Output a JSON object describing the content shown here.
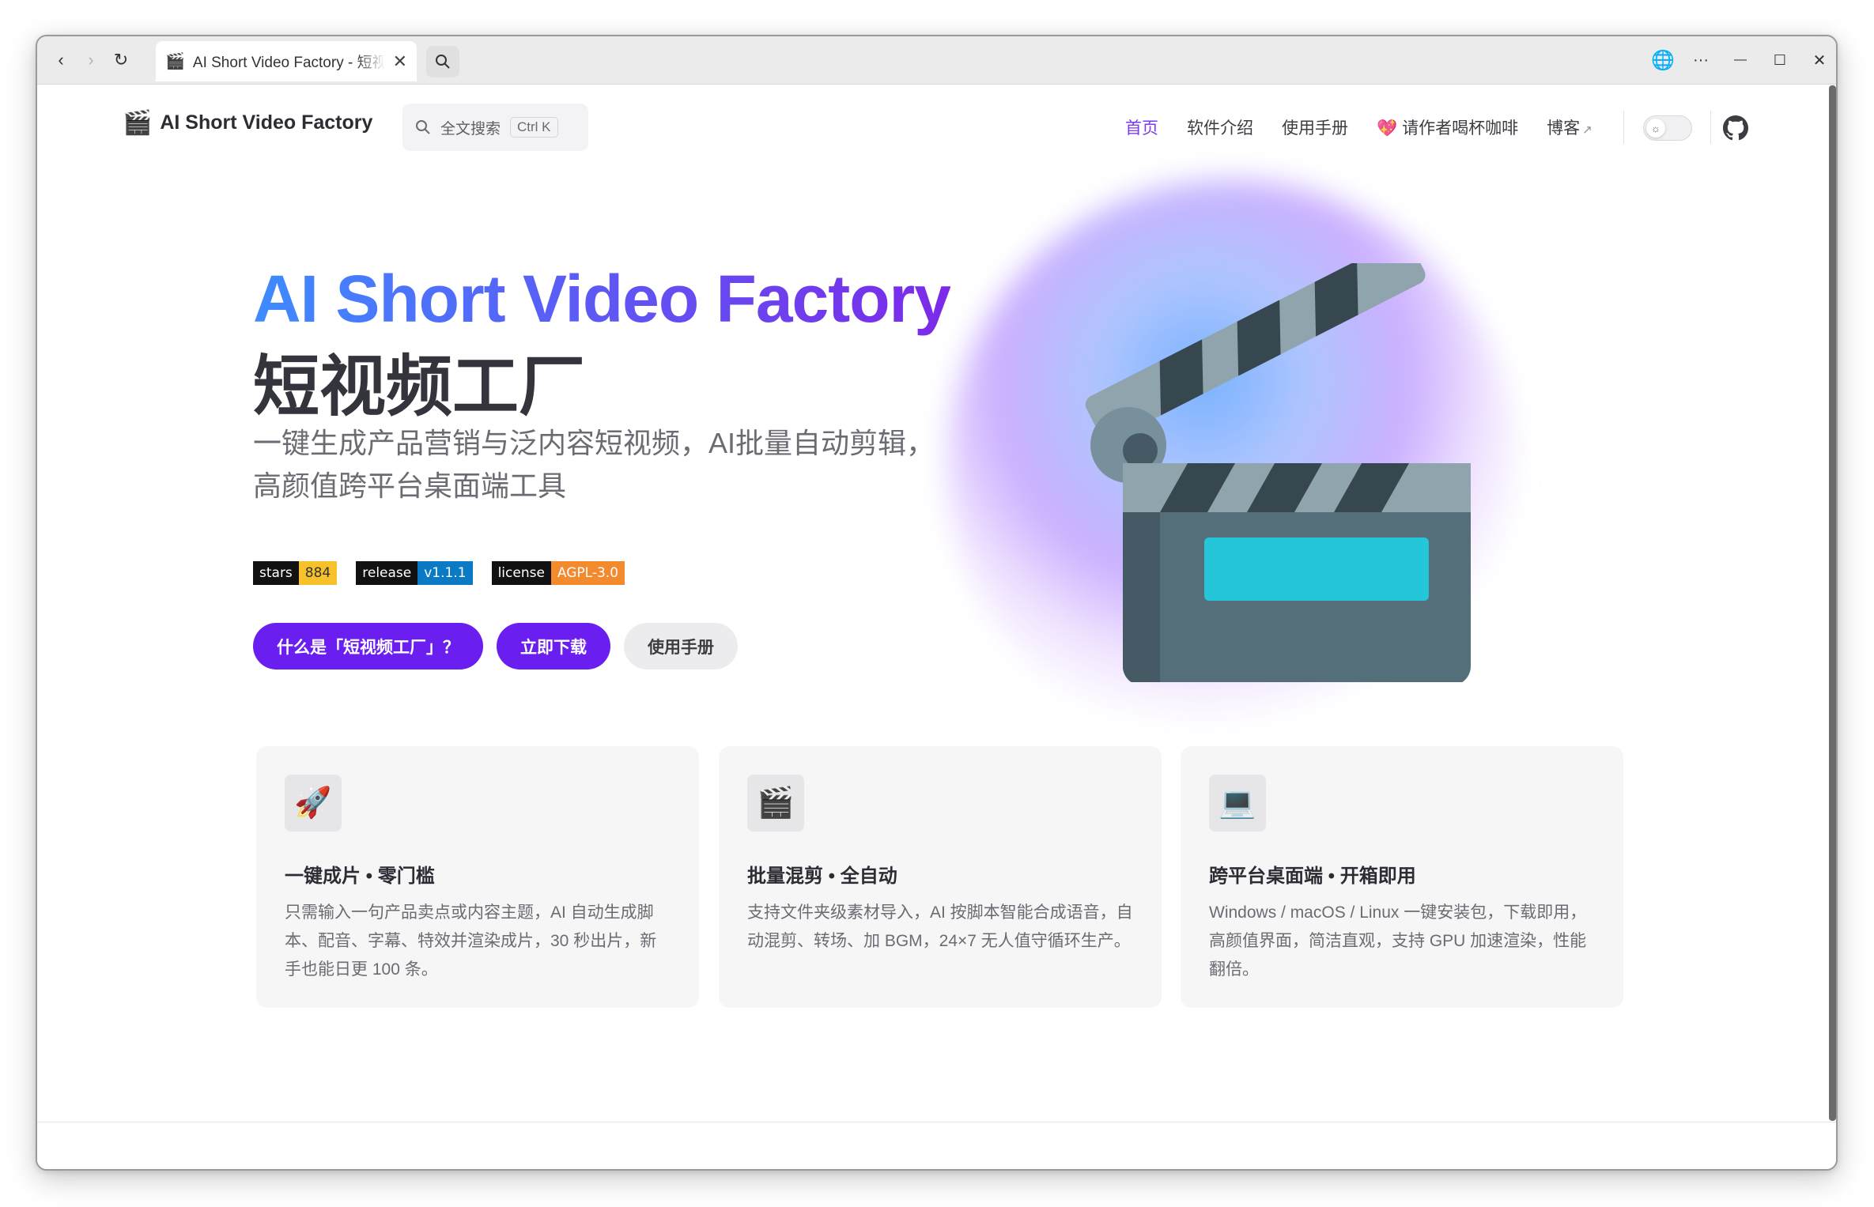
{
  "browser": {
    "tab_title": "AI Short Video Factory - 短视频工厂",
    "tab_favicon": "🎬",
    "back_icon": "‹",
    "forward_icon": "›",
    "reload_icon": "↻",
    "close_icon": "✕",
    "globe_icon": "🌐",
    "more_icon": "···",
    "minimize_icon": "—",
    "maximize_icon": "☐",
    "window_close_icon": "✕"
  },
  "nav": {
    "logo_icon": "🎬",
    "logo_text": "AI Short Video Factory",
    "search_placeholder": "全文搜索",
    "search_shortcut": "Ctrl K",
    "links": [
      {
        "label": "首页",
        "active": true
      },
      {
        "label": "软件介绍"
      },
      {
        "label": "使用手册"
      },
      {
        "label": "请作者喝杯咖啡",
        "icon": "💖"
      },
      {
        "label": "博客",
        "external": "↗"
      }
    ]
  },
  "hero": {
    "title": "AI Short Video Factory",
    "subtitle": "短视频工厂",
    "tagline_line1": "一键生成产品营销与泛内容短视频，AI批量自动剪辑，",
    "tagline_line2": "高颜值跨平台桌面端工具",
    "badges": [
      {
        "key": "stars",
        "value": "884",
        "color": "#f7c12b",
        "text_color": "#333"
      },
      {
        "key": "release",
        "value": "v1.1.1",
        "color": "#0a7ac4",
        "text_color": "#fff"
      },
      {
        "key": "license",
        "value": "AGPL-3.0",
        "color": "#f48a2e",
        "text_color": "#fff"
      }
    ],
    "buttons": [
      {
        "label": "什么是「短视频工厂」？",
        "style": "primary"
      },
      {
        "label": "立即下载",
        "style": "primary"
      },
      {
        "label": "使用手册",
        "style": "secondary"
      }
    ]
  },
  "features": [
    {
      "icon": "🚀",
      "title": "一键成片 • 零门槛",
      "desc": "只需输入一句产品卖点或内容主题，AI 自动生成脚本、配音、字幕、特效并渲染成片，30 秒出片，新手也能日更 100 条。"
    },
    {
      "icon": "🎬",
      "title": "批量混剪 • 全自动",
      "desc": "支持文件夹级素材导入，AI 按脚本智能合成语音，自动混剪、转场、加 BGM，24×7 无人值守循环生产。"
    },
    {
      "icon": "💻",
      "title": "跨平台桌面端 • 开箱即用",
      "desc": "Windows / macOS / Linux 一键安装包，下载即用，高颜值界面，简洁直观，支持 GPU 加速渲染，性能翻倍。"
    }
  ],
  "colors": {
    "brand": "#6a1ef0",
    "nav_active": "#7c3aed",
    "title_gradient_start": "#3e8bff",
    "title_gradient_end": "#7c2ae8"
  }
}
